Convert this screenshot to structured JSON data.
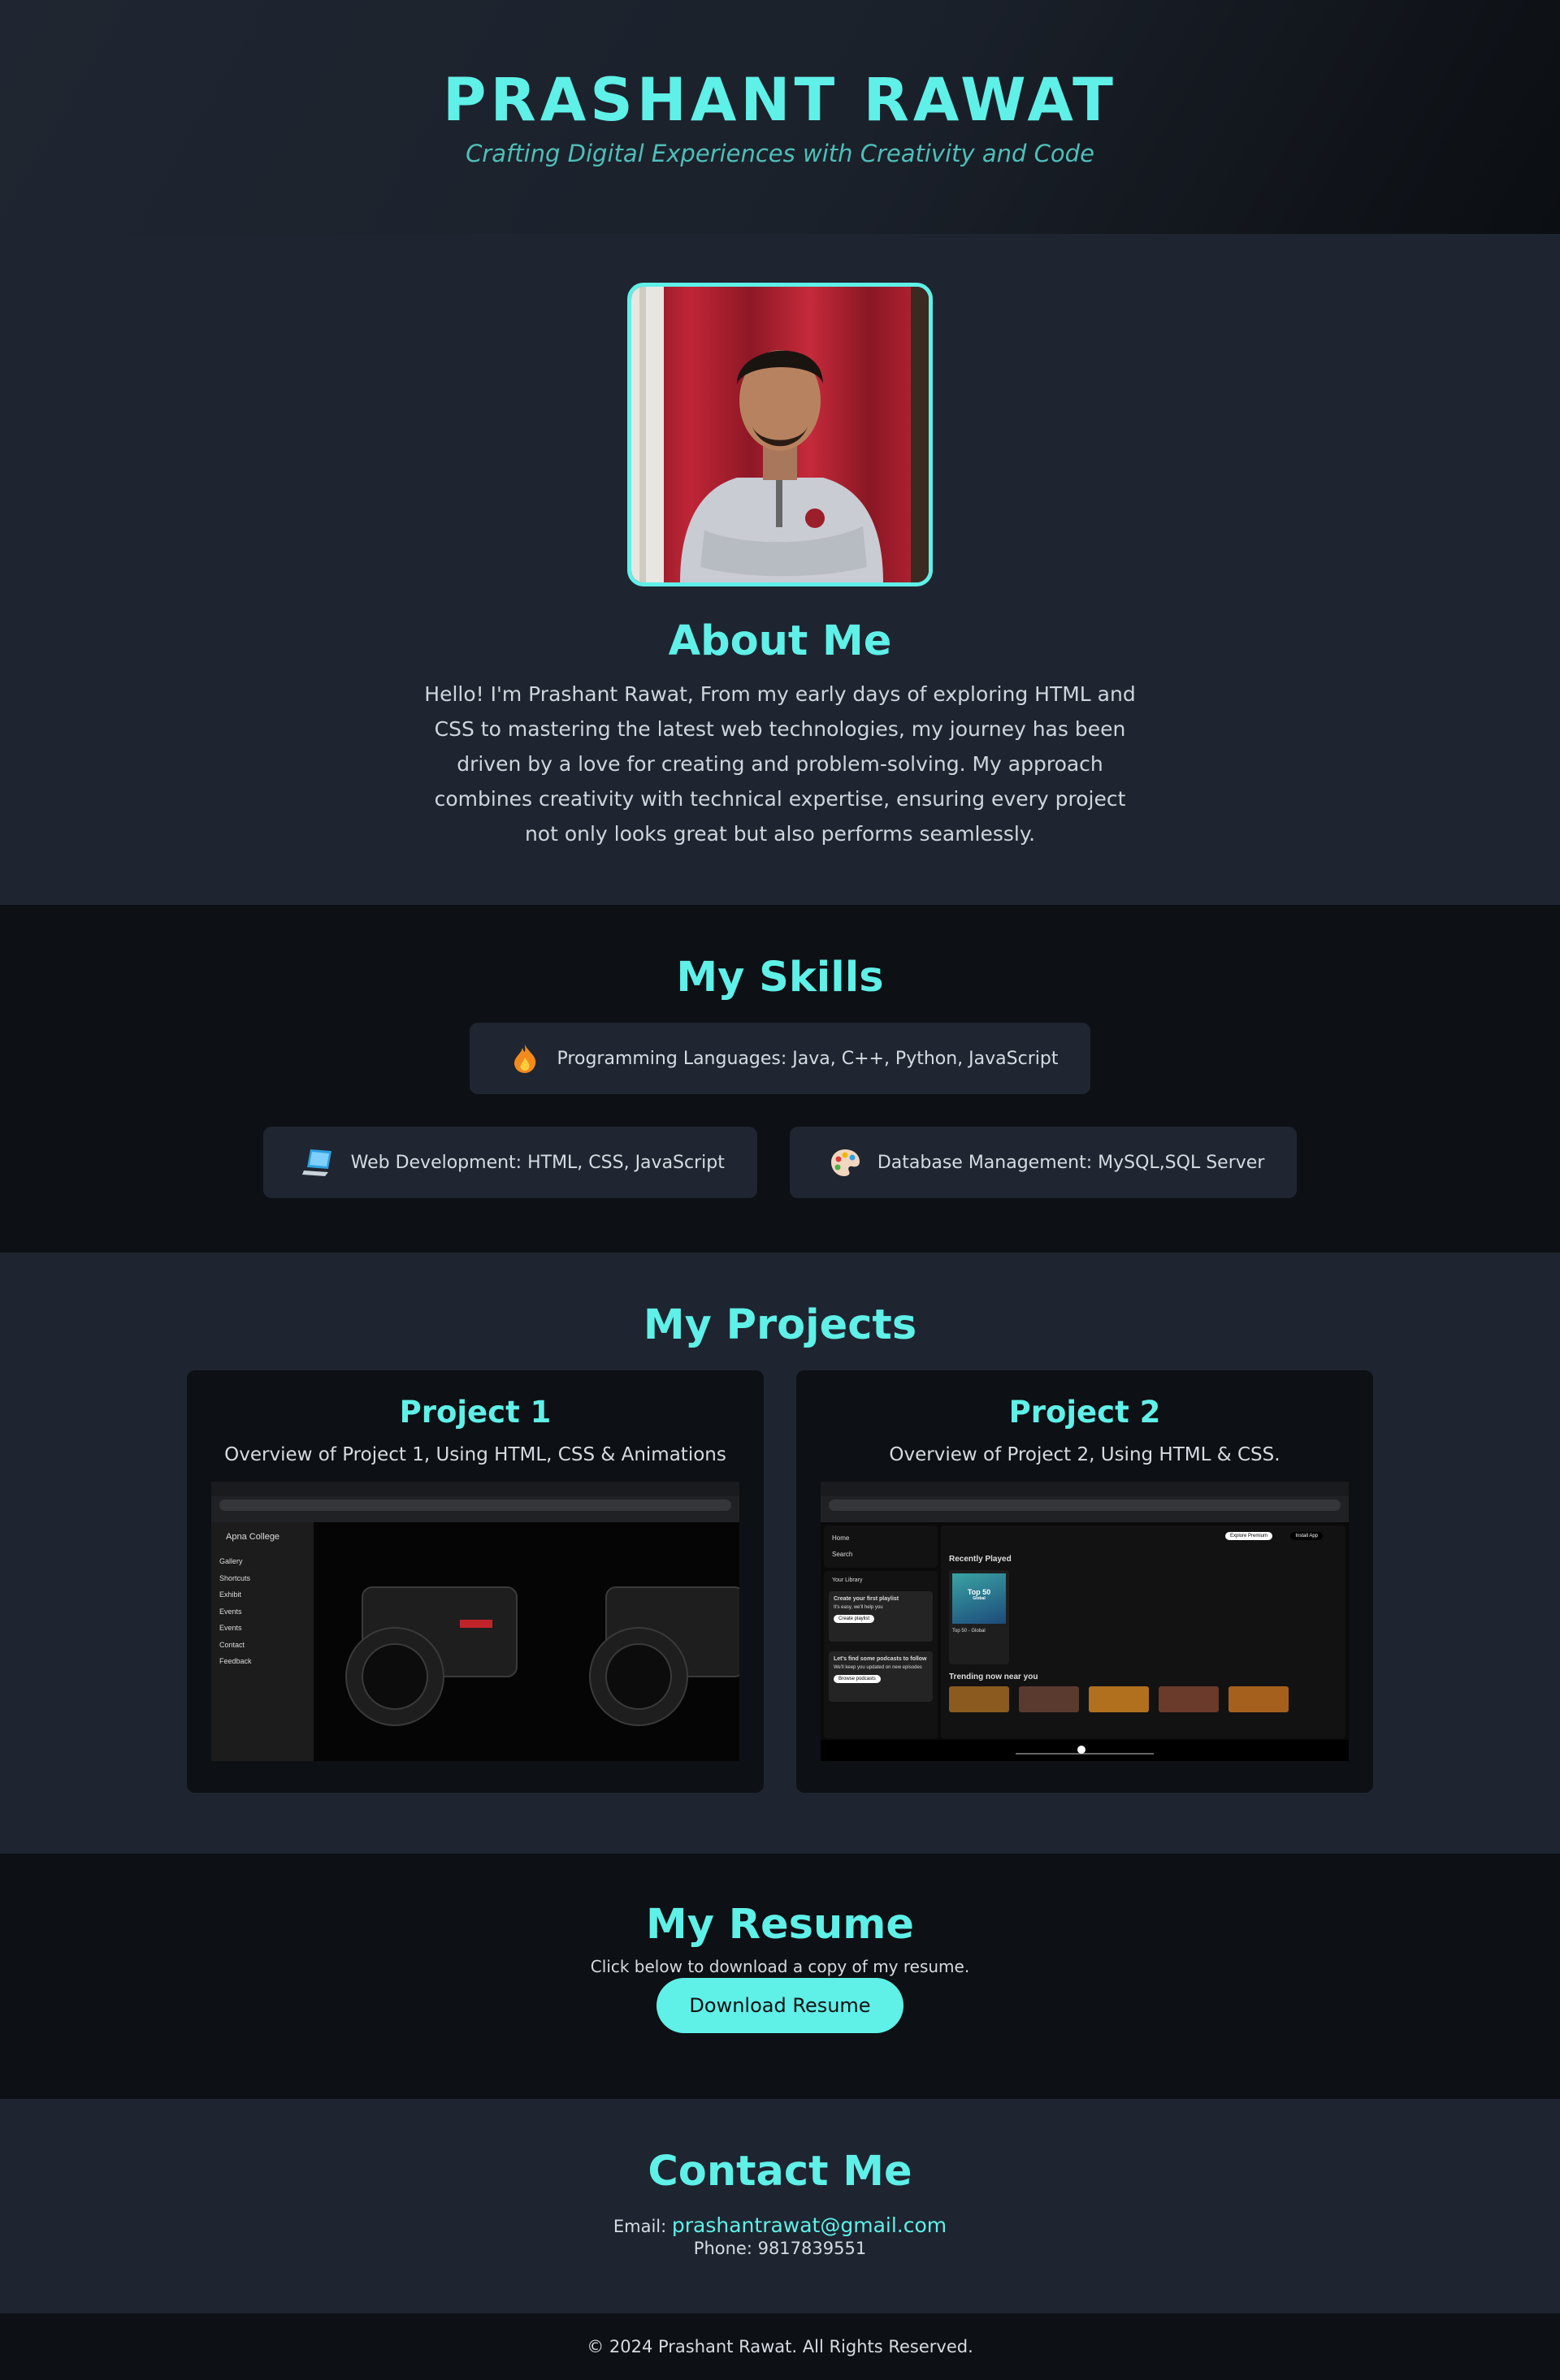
{
  "header": {
    "name": "PRASHANT RAWAT",
    "tagline": "Crafting Digital Experiences with Creativity and Code"
  },
  "about": {
    "title": "About Me",
    "text": "Hello! I'm Prashant Rawat, From my early days of exploring HTML and CSS to mastering the latest web technologies, my journey has been driven by a love for creating and problem-solving. My approach combines creativity with technical expertise, ensuring every project not only looks great but also performs seamlessly."
  },
  "skills": {
    "title": "My Skills",
    "items": [
      {
        "icon": "fire-icon",
        "label": "Programming Languages: Java, C++, Python, JavaScript"
      },
      {
        "icon": "laptop-icon",
        "label": "Web Development: HTML, CSS, JavaScript"
      },
      {
        "icon": "palette-icon",
        "label": "Database Management: MySQL,SQL Server"
      }
    ]
  },
  "projects": {
    "title": "My Projects",
    "items": [
      {
        "title": "Project 1",
        "desc": "Overview of Project 1, Using HTML, CSS & Animations",
        "screenshot": {
          "brand": "Apna College",
          "menu": [
            "Gallery",
            "Shortcuts",
            "Exhibit",
            "Events",
            "Events",
            "Contact",
            "Feedback"
          ]
        }
      },
      {
        "title": "Project 2",
        "desc": "Overview of Project 2, Using HTML & CSS.",
        "screenshot": {
          "nav": [
            "Home",
            "Search"
          ],
          "library": "Your Library",
          "box1_title": "Create your first playlist",
          "box1_sub": "It's easy, we'll help you",
          "box1_btn": "Create playlist",
          "box2_title": "Let's find some podcasts to follow",
          "box2_sub": "We'll keep you updated on new episodes",
          "box2_btn": "Browse podcasts",
          "recent": "Recently Played",
          "album": "Top 50",
          "album_sub": "Global",
          "album_title": "Top 50 - Global",
          "trending": "Trending now near you",
          "explore": "Explore Premium",
          "install": "Install App"
        }
      }
    ]
  },
  "resume": {
    "title": "My Resume",
    "text": "Click below to download a copy of my resume.",
    "button": "Download Resume"
  },
  "contact": {
    "title": "Contact Me",
    "email_label": "Email:",
    "email": "prashantrawat@gmail.com",
    "phone": "Phone: 9817839551"
  },
  "footer": {
    "text": "© 2024 Prashant Rawat. All Rights Reserved."
  },
  "colors": {
    "accent": "#5ff0e8",
    "dark": "#0d1014",
    "panel": "#1e2530"
  }
}
